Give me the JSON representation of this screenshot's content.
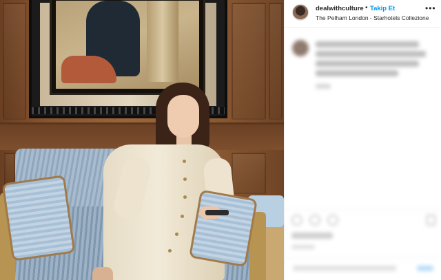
{
  "post": {
    "username": "dealwithculture",
    "separator": "•",
    "follow_label": "Takip Et",
    "location": "The Pelham London - Starhotels Collezione",
    "more_icon": "more-options-icon"
  },
  "colors": {
    "follow_accent": "#0095f6",
    "text_primary": "#262626",
    "border": "#efefef"
  },
  "icons": [
    "avatar",
    "heart-icon",
    "comment-icon",
    "share-icon",
    "bookmark-icon"
  ]
}
